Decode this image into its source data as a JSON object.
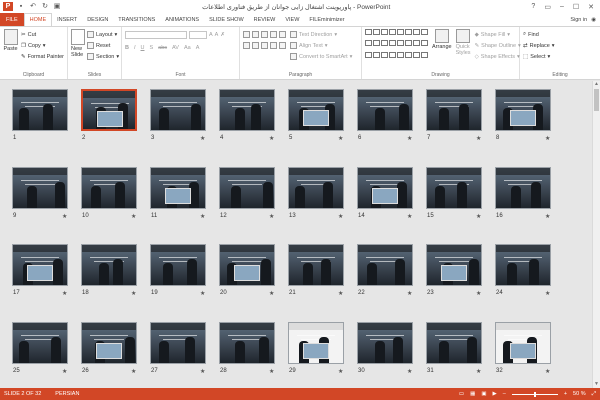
{
  "app": {
    "title": "پاورپوینت اشتغال زایی جوانان از طریق فناوری اطلاعات - PowerPoint",
    "icon_letter": "P",
    "accent": "#d24726"
  },
  "quick_access": [
    "save-icon",
    "undo-icon",
    "redo-icon",
    "start-icon"
  ],
  "window_buttons": [
    "?",
    "▭",
    "–",
    "☐",
    "✕"
  ],
  "tabs": [
    "FILE",
    "HOME",
    "INSERT",
    "DESIGN",
    "TRANSITIONS",
    "ANIMATIONS",
    "SLIDE SHOW",
    "REVIEW",
    "VIEW",
    "FILEminimizer"
  ],
  "active_tab": "HOME",
  "sign_in": "Sign in",
  "ribbon": {
    "clipboard": {
      "label": "Clipboard",
      "paste": "Paste",
      "cut": "Cut",
      "copy": "Copy",
      "format_painter": "Format Painter"
    },
    "slides": {
      "label": "Slides",
      "new_slide": "New Slide",
      "layout": "Layout",
      "reset": "Reset",
      "section": "Section"
    },
    "font": {
      "label": "Font",
      "bold": "B",
      "italic": "I",
      "underline": "U",
      "shadow": "S",
      "strike": "abc",
      "spacing": "AV",
      "case": "Aa",
      "color": "A"
    },
    "paragraph": {
      "label": "Paragraph",
      "text_direction": "Text Direction",
      "align_text": "Align Text",
      "convert_smartart": "Convert to SmartArt"
    },
    "drawing": {
      "label": "Drawing",
      "arrange": "Arrange",
      "quick_styles": "Quick Styles",
      "shape_fill": "Shape Fill",
      "shape_outline": "Shape Outline",
      "shape_effects": "Shape Effects"
    },
    "editing": {
      "label": "Editing",
      "find": "Find",
      "replace": "Replace",
      "select": "Select"
    }
  },
  "slides": [
    {
      "n": "1",
      "star": ""
    },
    {
      "n": "2",
      "star": "",
      "selected": true
    },
    {
      "n": "3",
      "star": "★"
    },
    {
      "n": "4",
      "star": "★"
    },
    {
      "n": "5",
      "star": "★"
    },
    {
      "n": "6",
      "star": "★"
    },
    {
      "n": "7",
      "star": "★"
    },
    {
      "n": "8",
      "star": "★"
    },
    {
      "n": "9",
      "star": "★"
    },
    {
      "n": "10",
      "star": "★"
    },
    {
      "n": "11",
      "star": "★"
    },
    {
      "n": "12",
      "star": "★"
    },
    {
      "n": "13",
      "star": "★"
    },
    {
      "n": "14",
      "star": "★"
    },
    {
      "n": "15",
      "star": "★"
    },
    {
      "n": "16",
      "star": "★"
    },
    {
      "n": "17",
      "star": "★"
    },
    {
      "n": "18",
      "star": "★"
    },
    {
      "n": "19",
      "star": "★"
    },
    {
      "n": "20",
      "star": "★"
    },
    {
      "n": "21",
      "star": "★"
    },
    {
      "n": "22",
      "star": "★"
    },
    {
      "n": "23",
      "star": "★"
    },
    {
      "n": "24",
      "star": "★"
    },
    {
      "n": "25",
      "star": "★"
    },
    {
      "n": "26",
      "star": "★"
    },
    {
      "n": "27",
      "star": "★"
    },
    {
      "n": "28",
      "star": "★"
    },
    {
      "n": "29",
      "star": "★"
    },
    {
      "n": "30",
      "star": "★"
    },
    {
      "n": "31",
      "star": "★"
    },
    {
      "n": "32",
      "star": "★"
    }
  ],
  "status": {
    "slide": "SLIDE 2 OF 32",
    "language": "PERSIAN",
    "zoom": "50 %"
  }
}
